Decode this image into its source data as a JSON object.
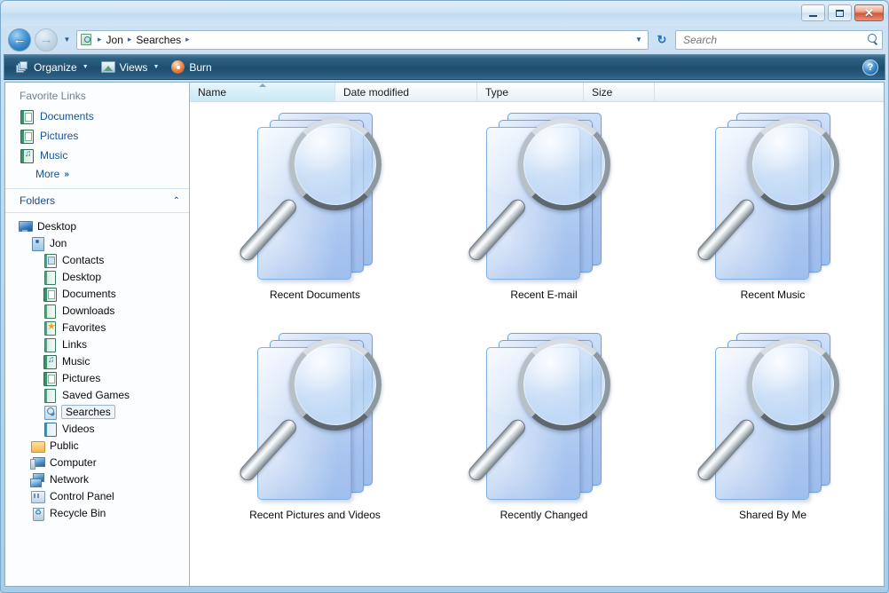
{
  "window": {
    "minimize_label": "–",
    "maximize_label": "",
    "close_label": "✕"
  },
  "nav": {
    "back_label": "←",
    "forward_label": "→",
    "history_dropdown_label": "▼",
    "address_dropdown_label": "▼",
    "refresh_label": "↻",
    "breadcrumbs": [
      "Jon",
      "Searches"
    ],
    "separator": "▸"
  },
  "search": {
    "placeholder": "Search",
    "value": ""
  },
  "toolbar": {
    "organize_label": "Organize",
    "views_label": "Views",
    "burn_label": "Burn",
    "caret": "▼",
    "help_label": "?"
  },
  "sidebar": {
    "favorites_header": "Favorite Links",
    "favorites": [
      {
        "label": "Documents",
        "icon": "documents-icon"
      },
      {
        "label": "Pictures",
        "icon": "pictures-icon"
      },
      {
        "label": "Music",
        "icon": "music-icon"
      }
    ],
    "more_label": "More",
    "more_chevron": "»",
    "folders_header": "Folders",
    "folders_chevron": "⌃",
    "tree": [
      {
        "label": "Desktop",
        "level": 0,
        "icon": "desktop-icon",
        "selected": false
      },
      {
        "label": "Jon",
        "level": 1,
        "icon": "user-folder-icon",
        "selected": false
      },
      {
        "label": "Contacts",
        "level": 2,
        "icon": "contacts-icon",
        "selected": false
      },
      {
        "label": "Desktop",
        "level": 2,
        "icon": "folder-icon",
        "selected": false
      },
      {
        "label": "Documents",
        "level": 2,
        "icon": "documents-icon",
        "selected": false
      },
      {
        "label": "Downloads",
        "level": 2,
        "icon": "folder-icon",
        "selected": false
      },
      {
        "label": "Favorites",
        "level": 2,
        "icon": "favorites-star-icon",
        "selected": false
      },
      {
        "label": "Links",
        "level": 2,
        "icon": "folder-icon",
        "selected": false
      },
      {
        "label": "Music",
        "level": 2,
        "icon": "music-icon",
        "selected": false
      },
      {
        "label": "Pictures",
        "level": 2,
        "icon": "pictures-icon",
        "selected": false
      },
      {
        "label": "Saved Games",
        "level": 2,
        "icon": "folder-icon",
        "selected": false
      },
      {
        "label": "Searches",
        "level": 2,
        "icon": "search-folder-icon",
        "selected": true
      },
      {
        "label": "Videos",
        "level": 2,
        "icon": "videos-icon",
        "selected": false
      },
      {
        "label": "Public",
        "level": 1,
        "icon": "public-folder-icon",
        "selected": false
      },
      {
        "label": "Computer",
        "level": 1,
        "icon": "computer-icon",
        "selected": false
      },
      {
        "label": "Network",
        "level": 1,
        "icon": "network-icon",
        "selected": false
      },
      {
        "label": "Control Panel",
        "level": 1,
        "icon": "control-panel-icon",
        "selected": false
      },
      {
        "label": "Recycle Bin",
        "level": 1,
        "icon": "recycle-bin-icon",
        "selected": false
      }
    ]
  },
  "columns": [
    {
      "label": "Name",
      "sorted": true,
      "sort_direction": "asc"
    },
    {
      "label": "Date modified",
      "sorted": false,
      "sort_direction": ""
    },
    {
      "label": "Type",
      "sorted": false,
      "sort_direction": ""
    },
    {
      "label": "Size",
      "sorted": false,
      "sort_direction": ""
    }
  ],
  "items": [
    {
      "label": "Recent Documents",
      "icon": "saved-search-icon"
    },
    {
      "label": "Recent E-mail",
      "icon": "saved-search-icon"
    },
    {
      "label": "Recent Music",
      "icon": "saved-search-icon"
    },
    {
      "label": "Recent Pictures and Videos",
      "icon": "saved-search-icon"
    },
    {
      "label": "Recently Changed",
      "icon": "saved-search-icon"
    },
    {
      "label": "Shared By Me",
      "icon": "saved-search-icon"
    }
  ],
  "colors": {
    "accent": "#1d4e70",
    "link": "#15539e",
    "folder_blue": "#a8c4ee",
    "close_red": "#d2563a",
    "sorted_header": "#cbe9f6"
  }
}
